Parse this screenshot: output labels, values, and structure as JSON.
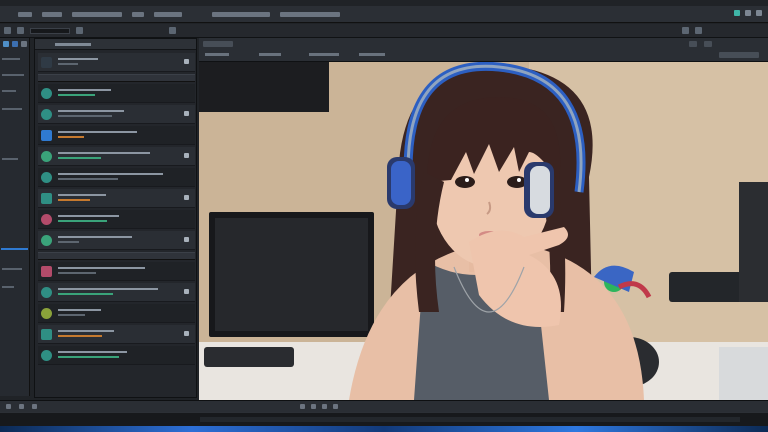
{
  "app": {
    "accent_color": "#2f7ad1",
    "secondary_accent": "#2f8f84",
    "background_color": "#202327"
  },
  "menubar": {
    "items": [
      "menu-1",
      "menu-2",
      "menu-3",
      "menu-4",
      "menu-5",
      "menu-6",
      "menu-7"
    ],
    "window_controls": [
      "minimize-icon",
      "maximize-icon",
      "close-icon"
    ]
  },
  "toolbar": {
    "icons": [
      "folder-icon",
      "save-icon",
      "undo-icon",
      "redo-icon",
      "play-icon",
      "settings-icon"
    ]
  },
  "left_panel": {
    "rows": [
      {
        "icon": "camera-icon"
      },
      {
        "icon": "scene-icon"
      },
      {
        "icon": "audio-icon"
      },
      {
        "icon": "image-icon"
      },
      {
        "icon": "video-icon"
      },
      {
        "icon": "text-icon"
      },
      {
        "icon": "source-icon"
      },
      {
        "icon": "filter-icon"
      },
      {
        "icon": "mic-icon"
      },
      {
        "icon": "effects-icon"
      },
      {
        "icon": "browser-icon"
      },
      {
        "icon": "layer-icon"
      },
      {
        "icon": "capture-icon"
      },
      {
        "icon": "display-icon"
      }
    ]
  },
  "viewport": {
    "scene": "webcam-preview"
  },
  "statusbar": {
    "icons": [
      "record-icon",
      "stream-icon",
      "cpu-icon",
      "fps-icon",
      "time-icon"
    ]
  }
}
